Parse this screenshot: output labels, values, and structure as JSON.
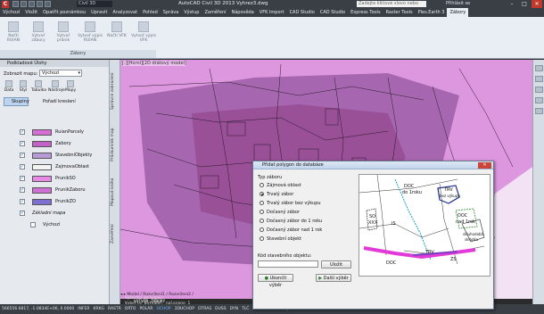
{
  "titlebar": {
    "app_logo": "C",
    "file_box": "Civil 3D",
    "title": "AutoCAD Civil 3D 2013    Vyhrez3.dwg",
    "search_placeholder": "Zadejte klíčové slovo nebo výraz",
    "login": "Přihlásit se",
    "min": "–",
    "max": "□",
    "close": "✕"
  },
  "tabs": [
    "Výchozí",
    "Vložit",
    "Opatřit poznámkou",
    "Upravit",
    "Analyzovat",
    "Pohled",
    "Správa",
    "Výstup",
    "Zaměření",
    "Nápověda",
    "VFK Import",
    "CAD Studio",
    "CAD Studio",
    "Express Tools",
    "Raster Tools",
    "Ples.Earth 3",
    "Zábory"
  ],
  "active_tab": "Zábory",
  "ribbon": {
    "buttons": [
      "Načti RUIAN",
      "Vytvoř zábory",
      "Vytvoř průnik",
      "Vytvoř výpis RUIAN",
      "Načti VFK",
      "Vytvoř výpis VFK"
    ],
    "panel_label": "Zábory"
  },
  "palette": {
    "title": "Podkladové Úlohy",
    "map_label": "Zobrazit mapu:",
    "map_value": "Výchozí",
    "tools": [
      "Data",
      "Styl",
      "Tabulka",
      "Nástroje",
      "Mapy"
    ],
    "group_button": "Skupiny",
    "order_button": "Pořadí kreslení",
    "layers": [
      {
        "name": "RuianParcely",
        "checked": true,
        "color": "#d66cd6"
      },
      {
        "name": "Zabory",
        "checked": true,
        "color": "#c064c8"
      },
      {
        "name": "StavebniObjekty",
        "checked": true,
        "color": "#b89ad6"
      },
      {
        "name": "ZajmovaOblast",
        "checked": true,
        "color": "#f4f4f4"
      },
      {
        "name": "PrunikSO",
        "checked": true,
        "color": "#e68ae6"
      },
      {
        "name": "PrunikZaboru",
        "checked": true,
        "color": "#cf70d4"
      },
      {
        "name": "PrunikZO",
        "checked": true,
        "color": "#7d6fd0"
      },
      {
        "name": "Základní mapa",
        "checked": true,
        "color": ""
      },
      {
        "name": "Výchozí",
        "checked": false,
        "color": ""
      }
    ]
  },
  "side_tabs": [
    "Správce zobrazení",
    "Průzkumník map",
    "Mapová kniha",
    "Zaměření"
  ],
  "map": {
    "viewport_label": "[-][Horní][2D drátový model]",
    "layout_tabs": "◂ ▸ Model / Rozvržení1 / Rozvržení2 /",
    "colors": {
      "outer": "#c86fd2",
      "inner": "#8e3e8e",
      "background": "#f3e4f5"
    }
  },
  "command": {
    "line1": "Vyberte polygon: nalezeno 1",
    "line2": "Vyberte polygon:",
    "prompt": "VYTVOR_ZABORY"
  },
  "statusbar": [
    {
      "t": "566556.6817, -1.0834E+06, 0.0000",
      "on": false
    },
    {
      "t": "INFER",
      "on": false
    },
    {
      "t": "KRKG",
      "on": false
    },
    {
      "t": "RASTR",
      "on": false
    },
    {
      "t": "ORTO",
      "on": false
    },
    {
      "t": "POLÁR",
      "on": false
    },
    {
      "t": "UCHOP",
      "on": true
    },
    {
      "t": "3DUCHOP",
      "on": false
    },
    {
      "t": "OTRAS",
      "on": false
    },
    {
      "t": "DUSS",
      "on": false
    },
    {
      "t": "DYN",
      "on": false
    },
    {
      "t": "TLČ",
      "on": false
    },
    {
      "t": "TPY",
      "on": true
    },
    {
      "t": "VR",
      "on": false
    },
    {
      "t": "SC",
      "on": false
    },
    {
      "t": "dop.",
      "on": false
    },
    {
      "t": "MODEL",
      "on": false
    },
    {
      "t": "1:1",
      "on": false
    },
    {
      "t": "⌂",
      "on": false
    }
  ],
  "dialog": {
    "title": "Přidat polygon do databáze",
    "close": "✕",
    "group_label": "Typ záboru",
    "options": [
      "Zájmová oblast",
      "Trvalý zábor",
      "Trvalý zábor bez výkupu",
      "Dočasný zábor",
      "Dočasný zábor do 1 roku",
      "Dočasný zábor nad 1 rok",
      "Stavební objekt"
    ],
    "selected": 1,
    "object_code_label": "Kód stavebního objektu:",
    "save_button": "Uložit",
    "end_button": "Ukončit výběr",
    "next_button": "Další výběr",
    "preview_labels": {
      "doc1": "DOC",
      "doc1b": "do 1roku",
      "trv": "TRV",
      "trv2": "bez výkupu",
      "doc2": "DOC",
      "doc2b": "nad 1rok",
      "so": "SO",
      "xxx": "XXX",
      "is": "IS",
      "doc3": "DOC",
      "trv3": "TRV",
      "zs": "ZS",
      "sklad1": "skluhodobá",
      "sklad2": "skládka"
    }
  }
}
